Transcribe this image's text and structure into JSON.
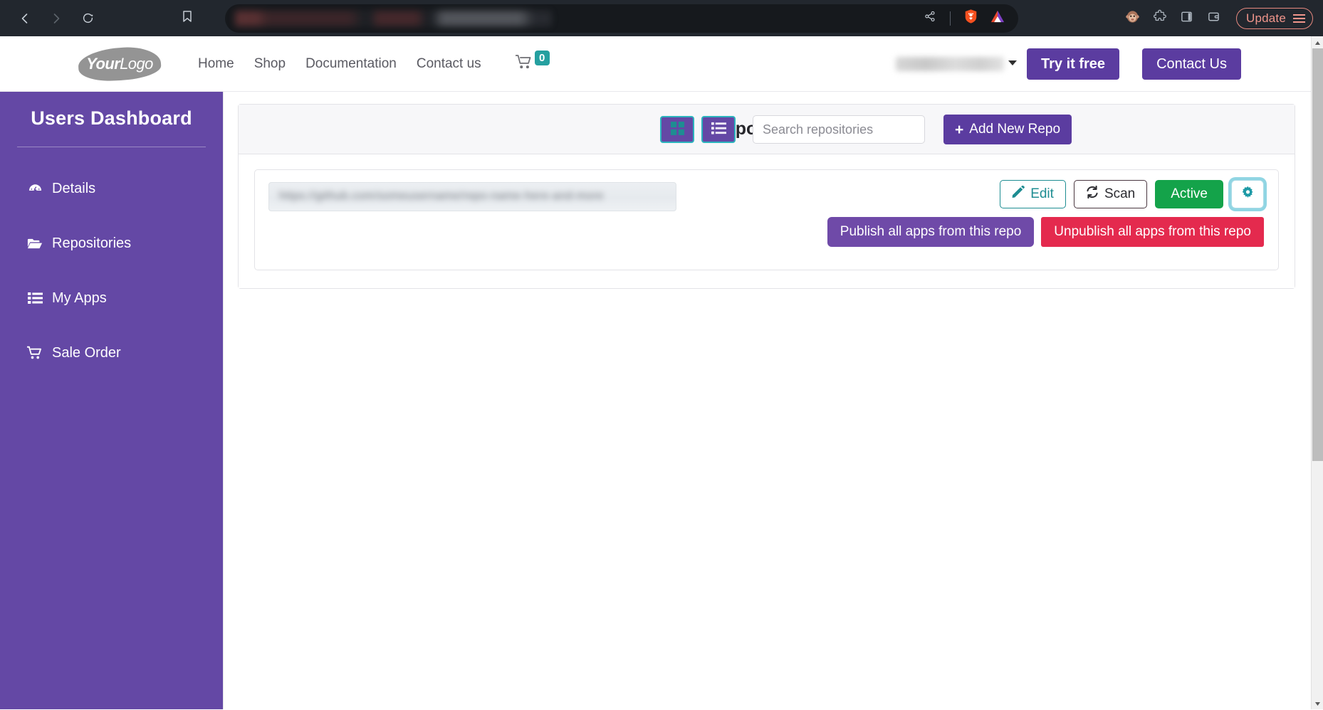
{
  "browser": {
    "back_icon": "back-arrow-icon",
    "forward_icon": "forward-arrow-icon",
    "reload_icon": "reload-icon",
    "bookmark_icon": "bookmark-icon",
    "url_value": "",
    "url_redacted": true,
    "share_icon": "share-icon",
    "shield_icon": "brave-shield-lion-icon",
    "rewards_icon": "brave-rewards-triangle-icon",
    "extension_monkey_icon": "monkey-extension-icon",
    "extension_puzzle_icon": "puzzle-extension-icon",
    "sidebar_panel_icon": "sidebar-panel-icon",
    "wallet_icon": "wallet-icon",
    "update_label": "Update",
    "menu_icon": "hamburger-menu-icon",
    "chrome_bg": "#22272e",
    "url_bg": "#16191d",
    "update_accent": "#f0958b"
  },
  "site_header": {
    "logo_bold": "Your",
    "logo_light": "Logo",
    "nav": [
      {
        "label": "Home"
      },
      {
        "label": "Shop"
      },
      {
        "label": "Documentation"
      },
      {
        "label": "Contact us"
      }
    ],
    "cart_icon": "shopping-cart-icon",
    "cart_count": "0",
    "cart_badge_color": "#25a0a0",
    "user_select_value": "",
    "user_select_redacted": true,
    "try_free_label": "Try it free",
    "contact_us_label": "Contact Us",
    "button_color": "#5b3ca0"
  },
  "sidebar": {
    "title": "Users Dashboard",
    "bg_color": "#6448a5",
    "items": [
      {
        "label": "Details",
        "icon": "dashboard-gauge-icon"
      },
      {
        "label": "Repositories",
        "icon": "open-folder-icon"
      },
      {
        "label": "My Apps",
        "icon": "list-icon"
      },
      {
        "label": "Sale Order",
        "icon": "shopping-cart-icon"
      }
    ]
  },
  "panel": {
    "title": "Repositories",
    "grid_view_icon": "grid-view-icon",
    "list_view_icon": "list-view-icon",
    "view_btn_bg": "#6448a5",
    "view_btn_border": "#2bb3bd",
    "search_placeholder": "Search repositories",
    "search_value": "",
    "add_repo_label": "Add New Repo",
    "add_repo_plus": "+"
  },
  "repo": {
    "name_value": "",
    "name_redacted": true,
    "name_blur_text": "https://github.com/someusername/repo-name-here-and-more",
    "actions": {
      "edit_label": "Edit",
      "edit_icon": "pencil-icon",
      "edit_color": "#1e8d92",
      "scan_label": "Scan",
      "scan_icon": "refresh-sync-icon",
      "scan_color": "#2c2c31",
      "status_label": "Active",
      "status_color": "#14a34a",
      "settings_icon": "gear-icon",
      "settings_color": "#1e9aa6"
    },
    "publish_label": "Publish all apps from this repo",
    "publish_color": "#6f4aa8",
    "unpublish_label": "Unpublish all apps from this repo",
    "unpublish_color": "#e42a4e"
  },
  "scrollbar": {
    "up_icon": "scroll-up-arrow-icon",
    "down_icon": "scroll-down-arrow-icon",
    "thumb": "scrollbar-thumb"
  }
}
